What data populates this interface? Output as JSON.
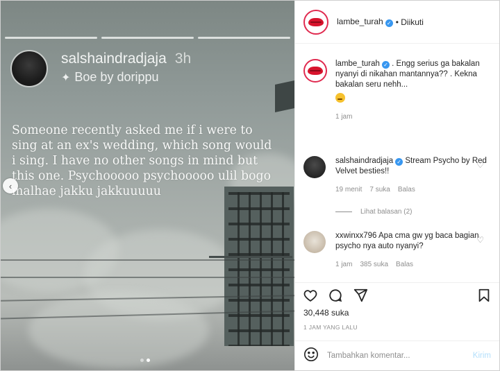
{
  "story": {
    "username": "salshaindradjaja",
    "time": "3h",
    "music": "Boe by dorippu",
    "text": "Someone recently asked me if i were to sing at an ex's wedding, which song would i sing. I have no other songs in mind but this one. Psychooooo psychooooo ulil bogo malhae jakku jakkuuuuu",
    "progress_count": 3
  },
  "header": {
    "username": "lambe_turah",
    "verified_glyph": "✓",
    "follow_status": "• Diikuti"
  },
  "caption": {
    "username": "lambe_turah",
    "text": ". Engg serius ga bakalan nyanyi di nikahan mantannya?? . Kekna bakalan seru nehh...",
    "emoji": "thinking-face",
    "time": "1 jam"
  },
  "comments": [
    {
      "username": "salshaindradjaja",
      "text": "Stream Psycho by Red Velvet besties!!",
      "time": "19 menit",
      "likes": "7 suka",
      "reply": "Balas",
      "view_replies": "Lihat balasan (2)"
    },
    {
      "username": "xxwinxx796",
      "text": "Apa cma gw yg baca bagian psycho nya auto nyanyi?",
      "time": "1 jam",
      "likes": "385 suka",
      "reply": "Balas"
    }
  ],
  "post": {
    "likes": "30,448 suka",
    "date": "1 JAM YANG LALU",
    "comment_placeholder": "Tambahkan komentar...",
    "post_label": "Kirim"
  },
  "icons": [
    "heart-icon",
    "comment-icon",
    "share-icon",
    "bookmark-icon",
    "emoji-icon",
    "sparkle-icon",
    "prev-arrow-icon"
  ],
  "colors": {
    "verified": "#3897f0",
    "brand_red": "#d8142d",
    "muted": "#8e8e8e",
    "post_disabled": "#b2dffc"
  }
}
